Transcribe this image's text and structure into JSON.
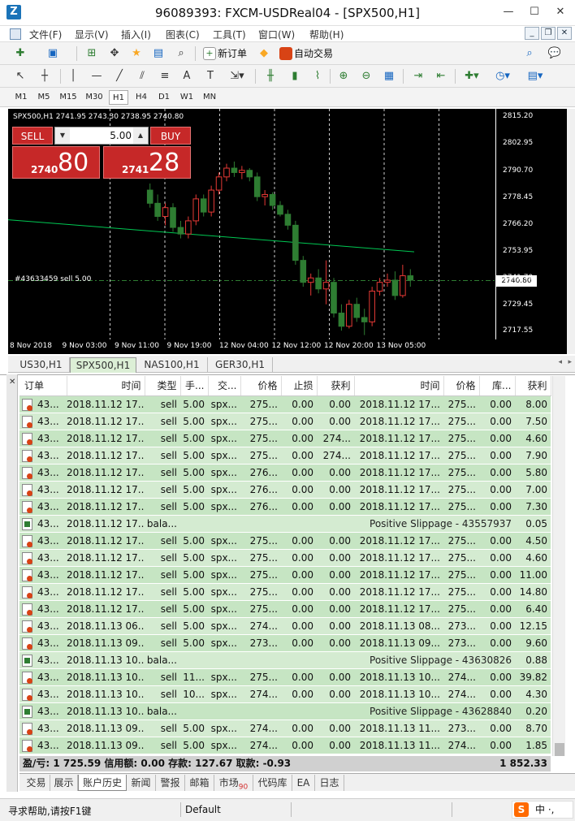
{
  "window": {
    "title": "96089393: FXCM-USDReal04 - [SPX500,H1]",
    "app_icon": "Z"
  },
  "menu": [
    "文件(F)",
    "显示(V)",
    "插入(I)",
    "图表(C)",
    "工具(T)",
    "窗口(W)",
    "帮助(H)"
  ],
  "toolbar": {
    "new_order": "新订单",
    "auto_trading": "自动交易"
  },
  "timeframes": [
    "M1",
    "M5",
    "M15",
    "M30",
    "H1",
    "H4",
    "D1",
    "W1",
    "MN"
  ],
  "active_timeframe": "H1",
  "chart": {
    "header": "SPX500,H1  2741.95 2743.30 2738.95 2740.80",
    "order_line_label": "#43633459 sell 5.00",
    "sell_label": "SELL",
    "buy_label": "BUY",
    "lot": "5.00",
    "sell_price_small": "2740",
    "sell_price_big": "80",
    "buy_price_small": "2741",
    "buy_price_big": "28",
    "current_price": "2740.80"
  },
  "chart_data": {
    "type": "candlestick",
    "y_ticks": [
      "2815.20",
      "2802.95",
      "2790.70",
      "2778.45",
      "2766.20",
      "2753.95",
      "2741.70",
      "2729.45",
      "2717.55"
    ],
    "x_ticks": [
      "8 Nov 2018",
      "9 Nov 03:00",
      "9 Nov 11:00",
      "9 Nov 19:00",
      "12 Nov 04:00",
      "12 Nov 12:00",
      "12 Nov 20:00",
      "13 Nov 05:00"
    ],
    "ylim": [
      2714,
      2819
    ],
    "candles": [
      [
        2782,
        2785,
        2774,
        2776
      ],
      [
        2776,
        2780,
        2768,
        2770
      ],
      [
        2770,
        2776,
        2766,
        2774
      ],
      [
        2774,
        2776,
        2763,
        2765
      ],
      [
        2765,
        2768,
        2760,
        2762
      ],
      [
        2762,
        2770,
        2760,
        2768
      ],
      [
        2768,
        2780,
        2766,
        2778
      ],
      [
        2778,
        2780,
        2770,
        2772
      ],
      [
        2772,
        2784,
        2770,
        2782
      ],
      [
        2782,
        2790,
        2780,
        2788
      ],
      [
        2788,
        2794,
        2786,
        2792
      ],
      [
        2792,
        2795,
        2788,
        2790
      ],
      [
        2790,
        2793,
        2787,
        2791
      ],
      [
        2791,
        2792,
        2786,
        2788
      ],
      [
        2788,
        2790,
        2777,
        2779
      ],
      [
        2779,
        2782,
        2775,
        2780
      ],
      [
        2780,
        2781,
        2773,
        2775
      ],
      [
        2775,
        2777,
        2770,
        2771
      ],
      [
        2771,
        2773,
        2764,
        2766
      ],
      [
        2766,
        2768,
        2748,
        2750
      ],
      [
        2750,
        2752,
        2738,
        2740
      ],
      [
        2740,
        2744,
        2734,
        2742
      ],
      [
        2742,
        2746,
        2735,
        2737
      ],
      [
        2737,
        2750,
        2730,
        2740
      ],
      [
        2740,
        2742,
        2724,
        2726
      ],
      [
        2726,
        2730,
        2718,
        2720
      ],
      [
        2720,
        2732,
        2719,
        2730
      ],
      [
        2730,
        2733,
        2722,
        2724
      ],
      [
        2724,
        2728,
        2716,
        2722
      ],
      [
        2722,
        2738,
        2720,
        2736
      ],
      [
        2736,
        2742,
        2734,
        2740
      ],
      [
        2740,
        2744,
        2738,
        2741
      ],
      [
        2741,
        2745,
        2732,
        2734
      ],
      [
        2734,
        2748,
        2733,
        2743
      ],
      [
        2743,
        2746,
        2738,
        2741
      ]
    ],
    "ma_line": [
      [
        0,
        2768.5
      ],
      [
        1,
        2753.9
      ]
    ]
  },
  "symbol_tabs": [
    "US30,H1",
    "SPX500,H1",
    "NAS100,H1",
    "GER30,H1"
  ],
  "active_symbol_tab": "SPX500,H1",
  "table": {
    "headers": [
      "订单",
      "时间",
      "类型",
      "手...",
      "交...",
      "价格",
      "止损",
      "获利",
      "时间",
      "价格",
      "库...",
      "获利"
    ],
    "rows": [
      [
        "43...",
        "2018.11.12 17...",
        "sell",
        "5.00",
        "spx...",
        "275...",
        "0.00",
        "0.00",
        "2018.11.12 17...",
        "275...",
        "0.00",
        "8.00"
      ],
      [
        "43...",
        "2018.11.12 17...",
        "sell",
        "5.00",
        "spx...",
        "275...",
        "0.00",
        "0.00",
        "2018.11.12 17...",
        "275...",
        "0.00",
        "7.50"
      ],
      [
        "43...",
        "2018.11.12 17...",
        "sell",
        "5.00",
        "spx...",
        "275...",
        "0.00",
        "274...",
        "2018.11.12 17...",
        "275...",
        "0.00",
        "4.60"
      ],
      [
        "43...",
        "2018.11.12 17...",
        "sell",
        "5.00",
        "spx...",
        "275...",
        "0.00",
        "274...",
        "2018.11.12 17...",
        "275...",
        "0.00",
        "7.90"
      ],
      [
        "43...",
        "2018.11.12 17...",
        "sell",
        "5.00",
        "spx...",
        "276...",
        "0.00",
        "0.00",
        "2018.11.12 17...",
        "275...",
        "0.00",
        "5.80"
      ],
      [
        "43...",
        "2018.11.12 17...",
        "sell",
        "5.00",
        "spx...",
        "276...",
        "0.00",
        "0.00",
        "2018.11.12 17...",
        "275...",
        "0.00",
        "7.00"
      ],
      [
        "43...",
        "2018.11.12 17...",
        "sell",
        "5.00",
        "spx...",
        "276...",
        "0.00",
        "0.00",
        "2018.11.12 17...",
        "275...",
        "0.00",
        "7.30"
      ],
      [
        "43...",
        "2018.11.12 17...",
        "bala...",
        "",
        "",
        "",
        "",
        "",
        "Positive Slippage - 43557937",
        "",
        "",
        "0.05"
      ],
      [
        "43...",
        "2018.11.12 17...",
        "sell",
        "5.00",
        "spx...",
        "275...",
        "0.00",
        "0.00",
        "2018.11.12 17...",
        "275...",
        "0.00",
        "4.50"
      ],
      [
        "43...",
        "2018.11.12 17...",
        "sell",
        "5.00",
        "spx...",
        "275...",
        "0.00",
        "0.00",
        "2018.11.12 17...",
        "275...",
        "0.00",
        "4.60"
      ],
      [
        "43...",
        "2018.11.12 17...",
        "sell",
        "5.00",
        "spx...",
        "275...",
        "0.00",
        "0.00",
        "2018.11.12 17...",
        "275...",
        "0.00",
        "11.00"
      ],
      [
        "43...",
        "2018.11.12 17...",
        "sell",
        "5.00",
        "spx...",
        "275...",
        "0.00",
        "0.00",
        "2018.11.12 17...",
        "275...",
        "0.00",
        "14.80"
      ],
      [
        "43...",
        "2018.11.12 17...",
        "sell",
        "5.00",
        "spx...",
        "275...",
        "0.00",
        "0.00",
        "2018.11.12 17...",
        "275...",
        "0.00",
        "6.40"
      ],
      [
        "43...",
        "2018.11.13 06...",
        "sell",
        "5.00",
        "spx...",
        "274...",
        "0.00",
        "0.00",
        "2018.11.13 08...",
        "273...",
        "0.00",
        "12.15"
      ],
      [
        "43...",
        "2018.11.13 09...",
        "sell",
        "5.00",
        "spx...",
        "273...",
        "0.00",
        "0.00",
        "2018.11.13 09...",
        "273...",
        "0.00",
        "9.60"
      ],
      [
        "43...",
        "2018.11.13 10...",
        "bala...",
        "",
        "",
        "",
        "",
        "",
        "Positive Slippage - 43630826",
        "",
        "",
        "0.88"
      ],
      [
        "43...",
        "2018.11.13 10...",
        "sell",
        "11...",
        "spx...",
        "275...",
        "0.00",
        "0.00",
        "2018.11.13 10...",
        "274...",
        "0.00",
        "39.82"
      ],
      [
        "43...",
        "2018.11.13 10...",
        "sell",
        "10...",
        "spx...",
        "274...",
        "0.00",
        "0.00",
        "2018.11.13 10...",
        "274...",
        "0.00",
        "4.30"
      ],
      [
        "43...",
        "2018.11.13 10...",
        "bala...",
        "",
        "",
        "",
        "",
        "",
        "Positive Slippage - 43628840",
        "",
        "",
        "0.20"
      ],
      [
        "43...",
        "2018.11.13 09...",
        "sell",
        "5.00",
        "spx...",
        "274...",
        "0.00",
        "0.00",
        "2018.11.13 11...",
        "273...",
        "0.00",
        "8.70"
      ],
      [
        "43...",
        "2018.11.13 09...",
        "sell",
        "5.00",
        "spx...",
        "274...",
        "0.00",
        "0.00",
        "2018.11.13 11...",
        "274...",
        "0.00",
        "1.85"
      ]
    ]
  },
  "totals": {
    "left": "盈/亏: 1 725.59  信用额: 0.00  存款: 127.67  取款: -0.93",
    "right": "1 852.33"
  },
  "terminal_tabs": [
    "交易",
    "展示",
    "账户历史",
    "新闻",
    "警报",
    "邮箱",
    "市场",
    "代码库",
    "EA",
    "日志"
  ],
  "active_terminal_tab": "账户历史",
  "market_badge": "90",
  "status": {
    "help": "寻求帮助,请按F1键",
    "profile": "Default"
  },
  "ime": {
    "logo": "S",
    "text": "中 ·,"
  },
  "colors": {
    "bull": "#e53935",
    "bear": "#2e7d32",
    "ma": "#00c853",
    "row_bg": "#c6e5c3"
  }
}
